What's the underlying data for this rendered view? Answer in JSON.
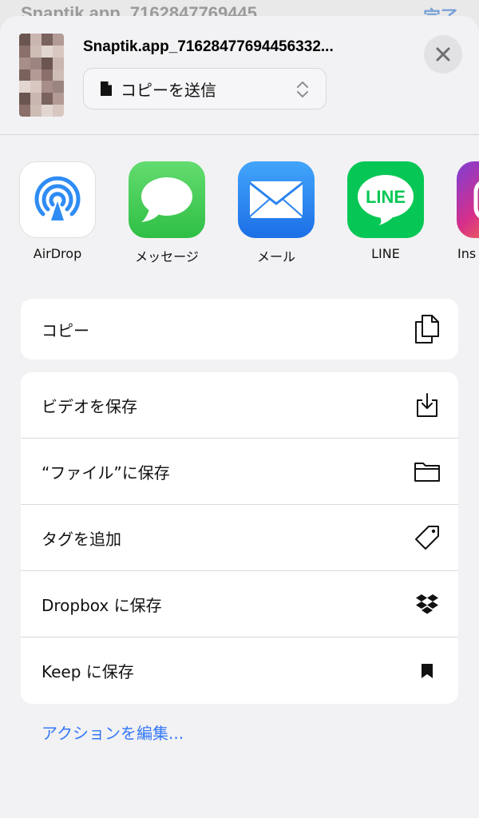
{
  "background": {
    "title": "Snaptik.app_7162847769445",
    "done_label": "完了"
  },
  "header": {
    "file_name": "Snaptik.app_71628477694456332...",
    "mode_label": "コピーを送信",
    "close_icon": "xmark-icon"
  },
  "apps": [
    {
      "label": "AirDrop",
      "icon": "airdrop-icon",
      "color": "#ffffff"
    },
    {
      "label": "メッセージ",
      "icon": "messages-icon",
      "color": "#34c759"
    },
    {
      "label": "メール",
      "icon": "mail-icon",
      "color": "#1e7cf2"
    },
    {
      "label": "LINE",
      "icon": "line-icon",
      "color": "#06c755",
      "text": "LINE"
    },
    {
      "label": "Ins",
      "icon": "instagram-icon",
      "color": "#c13584"
    }
  ],
  "actions": {
    "copy_group": [
      {
        "label": "コピー",
        "icon": "copy-doc-icon"
      }
    ],
    "main_group": [
      {
        "label": "ビデオを保存",
        "icon": "save-to-device-icon"
      },
      {
        "label": "“ファイル”に保存",
        "icon": "folder-icon"
      },
      {
        "label": "タグを追加",
        "icon": "tag-icon"
      },
      {
        "label": "Dropbox に保存",
        "icon": "dropbox-icon"
      },
      {
        "label": "Keep に保存",
        "icon": "bookmark-icon"
      }
    ]
  },
  "edit_actions_label": "アクションを編集..."
}
